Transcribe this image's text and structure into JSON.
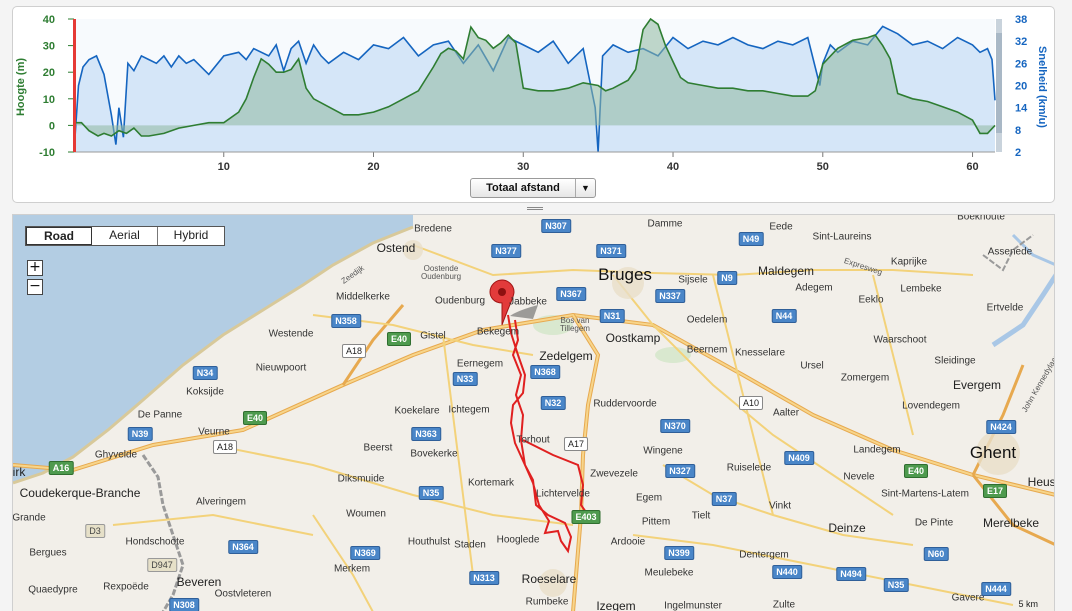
{
  "chart": {
    "left_axis_label": "Hoogte (m)",
    "right_axis_label": "Snelheid (km/u)",
    "left_ticks": [
      "40",
      "30",
      "20",
      "10",
      "0",
      "-10"
    ],
    "right_ticks": [
      "38",
      "32",
      "26",
      "20",
      "14",
      "8",
      "2"
    ],
    "x_ticks": [
      "10",
      "20",
      "30",
      "40",
      "50",
      "60"
    ],
    "distance_select": "Totaal afstand",
    "colors": {
      "elevation": "#2e7d32",
      "speed": "#1565c0",
      "marker": "#e53935"
    }
  },
  "chart_data": {
    "type": "area",
    "xlabel": "Totaal afstand",
    "xlim": [
      0,
      61.5
    ],
    "ylim_left": [
      -10,
      40
    ],
    "ylim_right": [
      2,
      38
    ],
    "ylabel_left": "Hoogte (m)",
    "ylabel_right": "Snelheid (km/u)",
    "series": [
      {
        "name": "Hoogte (m)",
        "axis": "left",
        "x": [
          0,
          0.5,
          1,
          1.6,
          2,
          2.5,
          3,
          3.5,
          4,
          4.5,
          5,
          6,
          7,
          8,
          9,
          10,
          11,
          11.5,
          12,
          12.5,
          13,
          13.5,
          14,
          14.5,
          15,
          15.5,
          16,
          17,
          18,
          19,
          20,
          21,
          22,
          23,
          24,
          24.5,
          25,
          25.5,
          26,
          26.5,
          27,
          27.5,
          28,
          28.5,
          29,
          29.5,
          30,
          31,
          32,
          33,
          34,
          35,
          35.5,
          36,
          37,
          37.5,
          38,
          38.5,
          39,
          39.5,
          40,
          40.5,
          41,
          42,
          43,
          44,
          45,
          46,
          47,
          48,
          49,
          49.5,
          50,
          50.5,
          51,
          52,
          53,
          53.5,
          54,
          54.5,
          55,
          56,
          57,
          58,
          59,
          60,
          60.5,
          61,
          61.5
        ],
        "values": [
          1,
          1,
          -2,
          -4,
          -3,
          -4,
          -2,
          -3,
          -1,
          -4,
          -4,
          -3,
          -1,
          0,
          1,
          1,
          5,
          10,
          18,
          25,
          23,
          20,
          20,
          21,
          25,
          14,
          10,
          7,
          4,
          4,
          5,
          7,
          10,
          13,
          22,
          27,
          29,
          28,
          25,
          37,
          33,
          32,
          29,
          31,
          34,
          31,
          14,
          13,
          13,
          14,
          16,
          15,
          13,
          14,
          17,
          21,
          36,
          40,
          38,
          30,
          24,
          18,
          16,
          15,
          14,
          14,
          13,
          13,
          12,
          11,
          11,
          13,
          23,
          26,
          29,
          32,
          33,
          34,
          30,
          25,
          12,
          10,
          9,
          7,
          5,
          2,
          -3,
          -3,
          0
        ]
      },
      {
        "name": "Snelheid (km/u)",
        "axis": "right",
        "x": [
          0,
          0.3,
          0.6,
          1,
          1.5,
          2,
          2.5,
          2.8,
          3,
          3.3,
          3.6,
          4,
          4.5,
          5,
          5.5,
          6,
          6.5,
          7,
          7.5,
          8,
          9,
          10,
          11,
          11.5,
          12,
          13,
          13.5,
          14,
          14.5,
          15,
          15.5,
          16,
          16.5,
          17,
          18,
          19,
          20,
          21,
          22,
          23,
          24,
          25,
          26,
          27,
          28,
          29,
          30,
          31,
          32,
          33,
          34,
          34.8,
          35,
          35.3,
          36,
          37,
          38,
          39,
          40,
          41,
          42,
          43,
          44,
          45,
          46,
          47,
          48,
          49,
          49.8,
          50,
          50.5,
          51,
          52,
          53,
          54,
          55,
          56,
          57,
          58,
          59,
          60,
          60.5,
          61,
          61.3,
          61.5
        ],
        "values": [
          2,
          20,
          25,
          27,
          28,
          23,
          12,
          4,
          14,
          6,
          26,
          24,
          28,
          27,
          26,
          28,
          25,
          28,
          26,
          27,
          23,
          28,
          29,
          27,
          30,
          28,
          31,
          24,
          30,
          32,
          26,
          31,
          28,
          26,
          29,
          27,
          31,
          30,
          33,
          28,
          31,
          32,
          26,
          31,
          24,
          33,
          31,
          29,
          32,
          26,
          30,
          14,
          2,
          28,
          31,
          29,
          30,
          28,
          33,
          30,
          32,
          31,
          33,
          31,
          30,
          32,
          31,
          33,
          20,
          26,
          31,
          29,
          32,
          31,
          36,
          34,
          31,
          32,
          30,
          33,
          31,
          29,
          30,
          27,
          16
        ]
      }
    ],
    "grid": false,
    "legend": "none"
  },
  "map": {
    "map_types": [
      "Road",
      "Aerial",
      "Hybrid"
    ],
    "active_type": "Road",
    "zoom_in": "+",
    "zoom_out": "−",
    "scale": "5 km",
    "places": [
      {
        "name": "Bruges",
        "size": "xl"
      },
      {
        "name": "Ghent",
        "size": "xl"
      },
      {
        "name": "Ostend",
        "size": "l"
      },
      {
        "name": "Bredene",
        "size": "s"
      },
      {
        "name": "Oostende Oudenburg",
        "size": "xs"
      },
      {
        "name": "Zeedijk",
        "size": "xs"
      },
      {
        "name": "Middelkerke",
        "size": "s"
      },
      {
        "name": "Oudenburg",
        "size": "s"
      },
      {
        "name": "Jabbeke",
        "size": "s"
      },
      {
        "name": "Bekegem",
        "size": "s"
      },
      {
        "name": "Gistel",
        "size": "s"
      },
      {
        "name": "Westende",
        "size": "s"
      },
      {
        "name": "Nieuwpoort",
        "size": "s"
      },
      {
        "name": "Koksijde",
        "size": "s"
      },
      {
        "name": "De Panne",
        "size": "s"
      },
      {
        "name": "Veurne",
        "size": "s"
      },
      {
        "name": "Ghyvelde",
        "size": "s"
      },
      {
        "name": "Coudekerque-Branche",
        "size": "l"
      },
      {
        "name": "Grande",
        "size": "s"
      },
      {
        "name": "Bergues",
        "size": "s"
      },
      {
        "name": "Hondschoote",
        "size": "s"
      },
      {
        "name": "Quaedypre",
        "size": "s"
      },
      {
        "name": "Rexpoëde",
        "size": "s"
      },
      {
        "name": "Beveren",
        "size": "l"
      },
      {
        "name": "Oostvleteren",
        "size": "s"
      },
      {
        "name": "Alveringem",
        "size": "s"
      },
      {
        "name": "Diksmuide",
        "size": "s"
      },
      {
        "name": "Woumen",
        "size": "s"
      },
      {
        "name": "Beerst",
        "size": "s"
      },
      {
        "name": "Bovekerke",
        "size": "s"
      },
      {
        "name": "Koekelare",
        "size": "s"
      },
      {
        "name": "Ichtegem",
        "size": "s"
      },
      {
        "name": "Eernegem",
        "size": "s"
      },
      {
        "name": "Zedelgem",
        "size": "l"
      },
      {
        "name": "Bos van Tillegem",
        "size": "xs"
      },
      {
        "name": "Oostkamp",
        "size": "l"
      },
      {
        "name": "Torhout",
        "size": "s"
      },
      {
        "name": "Kortemark",
        "size": "s"
      },
      {
        "name": "Lichtervelde",
        "size": "s"
      },
      {
        "name": "Hooglede",
        "size": "s"
      },
      {
        "name": "Houthulst",
        "size": "s"
      },
      {
        "name": "Staden",
        "size": "s"
      },
      {
        "name": "Merkem",
        "size": "s"
      },
      {
        "name": "Roeselare",
        "size": "l"
      },
      {
        "name": "Rumbeke",
        "size": "s"
      },
      {
        "name": "Izegem",
        "size": "l"
      },
      {
        "name": "Ingelmunster",
        "size": "s"
      },
      {
        "name": "Ardooie",
        "size": "s"
      },
      {
        "name": "Pittem",
        "size": "s"
      },
      {
        "name": "Egem",
        "size": "s"
      },
      {
        "name": "Zwevezele",
        "size": "s"
      },
      {
        "name": "Wingene",
        "size": "s"
      },
      {
        "name": "Ruddervoorde",
        "size": "s"
      },
      {
        "name": "Tielt",
        "size": "s"
      },
      {
        "name": "Ruiselede",
        "size": "s"
      },
      {
        "name": "Meulebeke",
        "size": "s"
      },
      {
        "name": "Dentergem",
        "size": "s"
      },
      {
        "name": "Zulte",
        "size": "s"
      },
      {
        "name": "Vinkt",
        "size": "s"
      },
      {
        "name": "Deinze",
        "size": "l"
      },
      {
        "name": "Aalter",
        "size": "s"
      },
      {
        "name": "Beernem",
        "size": "s"
      },
      {
        "name": "Knesselare",
        "size": "s"
      },
      {
        "name": "Ursel",
        "size": "s"
      },
      {
        "name": "Oedelem",
        "size": "s"
      },
      {
        "name": "Sijsele",
        "size": "s"
      },
      {
        "name": "Maldegem",
        "size": "l"
      },
      {
        "name": "Adegem",
        "size": "s"
      },
      {
        "name": "Eeklo",
        "size": "s"
      },
      {
        "name": "Eede",
        "size": "s"
      },
      {
        "name": "Sint-Laureins",
        "size": "s"
      },
      {
        "name": "Damme",
        "size": "s"
      },
      {
        "name": "Kaprijke",
        "size": "s"
      },
      {
        "name": "Lembeke",
        "size": "s"
      },
      {
        "name": "Waarschoot",
        "size": "s"
      },
      {
        "name": "Zomergem",
        "size": "s"
      },
      {
        "name": "Lovendegem",
        "size": "s"
      },
      {
        "name": "Sleidinge",
        "size": "s"
      },
      {
        "name": "Evergem",
        "size": "l"
      },
      {
        "name": "Ertvelde",
        "size": "s"
      },
      {
        "name": "Assenede",
        "size": "s"
      },
      {
        "name": "Boekhoute",
        "size": "s"
      },
      {
        "name": "Landegem",
        "size": "s"
      },
      {
        "name": "Nevele",
        "size": "s"
      },
      {
        "name": "Sint-Martens-Latem",
        "size": "s"
      },
      {
        "name": "De Pinte",
        "size": "s"
      },
      {
        "name": "Merelbeke",
        "size": "l"
      },
      {
        "name": "Heusd",
        "size": "l"
      },
      {
        "name": "Gavere",
        "size": "s"
      },
      {
        "name": "Expresweg",
        "size": "xs"
      },
      {
        "name": "John Kennedylaan",
        "size": "xs"
      },
      {
        "name": "irk",
        "size": "l"
      }
    ],
    "roads": [
      {
        "label": "N377",
        "kind": "n"
      },
      {
        "label": "N307",
        "kind": "n"
      },
      {
        "label": "N371",
        "kind": "n"
      },
      {
        "label": "N49",
        "kind": "n"
      },
      {
        "label": "N367",
        "kind": "n"
      },
      {
        "label": "N337",
        "kind": "n"
      },
      {
        "label": "N9",
        "kind": "n"
      },
      {
        "label": "N31",
        "kind": "n"
      },
      {
        "label": "N358",
        "kind": "n"
      },
      {
        "label": "N44",
        "kind": "n"
      },
      {
        "label": "E40",
        "kind": "e"
      },
      {
        "label": "A18",
        "kind": "a"
      },
      {
        "label": "N33",
        "kind": "n"
      },
      {
        "label": "N368",
        "kind": "n"
      },
      {
        "label": "N34",
        "kind": "n"
      },
      {
        "label": "N32",
        "kind": "n"
      },
      {
        "label": "A10",
        "kind": "a"
      },
      {
        "label": "E40",
        "kind": "e"
      },
      {
        "label": "N39",
        "kind": "n"
      },
      {
        "label": "N363",
        "kind": "n"
      },
      {
        "label": "N370",
        "kind": "n"
      },
      {
        "label": "A18",
        "kind": "a"
      },
      {
        "label": "A17",
        "kind": "a"
      },
      {
        "label": "A16",
        "kind": "e"
      },
      {
        "label": "N409",
        "kind": "n"
      },
      {
        "label": "N424",
        "kind": "n"
      },
      {
        "label": "N327",
        "kind": "n"
      },
      {
        "label": "E40",
        "kind": "e"
      },
      {
        "label": "N35",
        "kind": "n"
      },
      {
        "label": "N37",
        "kind": "n"
      },
      {
        "label": "E17",
        "kind": "e"
      },
      {
        "label": "E403",
        "kind": "e"
      },
      {
        "label": "D3",
        "kind": "d"
      },
      {
        "label": "N364",
        "kind": "n"
      },
      {
        "label": "N369",
        "kind": "n"
      },
      {
        "label": "N399",
        "kind": "n"
      },
      {
        "label": "N60",
        "kind": "n"
      },
      {
        "label": "D947",
        "kind": "d"
      },
      {
        "label": "N440",
        "kind": "n"
      },
      {
        "label": "N494",
        "kind": "n"
      },
      {
        "label": "N35",
        "kind": "n"
      },
      {
        "label": "N313",
        "kind": "n"
      },
      {
        "label": "N444",
        "kind": "n"
      },
      {
        "label": "N308",
        "kind": "n"
      }
    ]
  }
}
